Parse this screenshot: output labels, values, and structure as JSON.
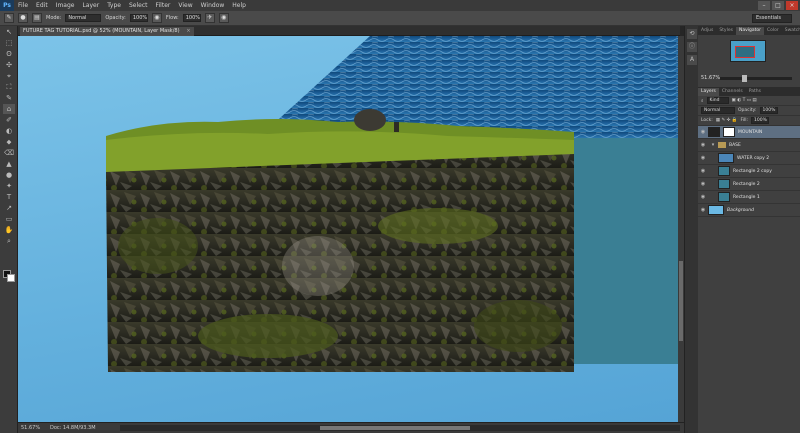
{
  "app": {
    "logo": "Ps",
    "menus": [
      "File",
      "Edit",
      "Image",
      "Layer",
      "Type",
      "Select",
      "Filter",
      "View",
      "Window",
      "Help"
    ],
    "window_controls": [
      "–",
      "□",
      "×"
    ]
  },
  "options_bar": {
    "mode_label": "Mode:",
    "mode_value": "Normal",
    "opacity_label": "Opacity:",
    "opacity_value": "100%",
    "flow_label": "Flow:",
    "flow_value": "100%",
    "workspace": "Essentials"
  },
  "document": {
    "tab_title": "FUTURE TAG TUTORIAL.psd @ 52% (MOUNTAIN, Layer Mask/8)",
    "zoom": "51.67%",
    "doc_info": "Doc: 14.8M/93.3M"
  },
  "tools": [
    "↖",
    "⬚",
    "ʘ",
    "✣",
    "⌖",
    "⛶",
    "✎",
    "⌂",
    "✐",
    "◐",
    "⬥",
    "⌫",
    "▲",
    "●",
    "✦",
    "T",
    "↗",
    "▭",
    "✋",
    "⌕"
  ],
  "panels": {
    "top_tabs": [
      "Adjus",
      "Styles",
      "Navigator",
      "Color",
      "Swatch"
    ],
    "active_top_tab": "Navigator",
    "navigator_zoom": "51.67%",
    "layer_tabs": [
      "Layers",
      "Channels",
      "Paths"
    ],
    "kind_label": "Kind",
    "blend_mode": "Normal",
    "opacity_label": "Opacity:",
    "opacity_value": "100%",
    "lock_label": "Lock:",
    "fill_label": "Fill:",
    "fill_value": "100%",
    "layers": [
      {
        "name": "MOUNTAIN",
        "thumb": "#222222",
        "selected": true
      },
      {
        "name": "BASE",
        "thumb": "folder",
        "selected": false
      },
      {
        "name": "WATER copy 2",
        "thumb": "#4b86b8",
        "selected": false
      },
      {
        "name": "Rectangle 2 copy",
        "thumb": "#3a7f94",
        "selected": false
      },
      {
        "name": "Rectangle 2",
        "thumb": "#3a7f94",
        "selected": false
      },
      {
        "name": "Rectangle 1",
        "thumb": "#3a7f94",
        "selected": false
      },
      {
        "name": "Background",
        "thumb": "#6bb9e4",
        "selected": false
      }
    ],
    "footer_icons": [
      "fx",
      "◧",
      "◑",
      "▢",
      "⊞",
      "🗑"
    ]
  },
  "colors": {
    "sky": "#6bb9e4",
    "teal_block": "#3a7f94",
    "sea": "#1d5a93"
  }
}
